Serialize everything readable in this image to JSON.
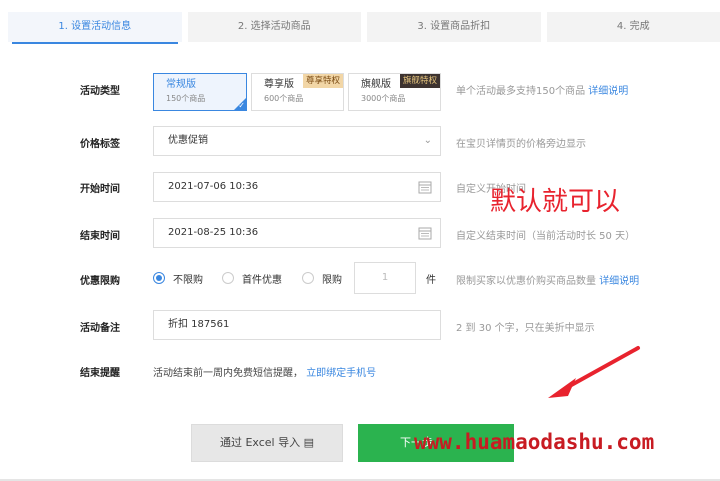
{
  "steps": [
    "1. 设置活动信息",
    "2. 选择活动商品",
    "3. 设置商品折扣",
    "4. 完成"
  ],
  "activity_type": {
    "label": "活动类型",
    "cards": [
      {
        "title": "常规版",
        "sub": "150个商品",
        "tag": ""
      },
      {
        "title": "尊享版",
        "sub": "600个商品",
        "tag": "尊享特权"
      },
      {
        "title": "旗舰版",
        "sub": "3000个商品",
        "tag": "旗舰特权"
      }
    ],
    "hint": "单个活动最多支持150个商品",
    "hint_link": "详细说明"
  },
  "price_tag": {
    "label": "价格标签",
    "value": "优惠促销",
    "hint": "在宝贝详情页的价格旁边显示"
  },
  "start_time": {
    "label": "开始时间",
    "value": "2021-07-06 10:36",
    "hint": "自定义开始时间"
  },
  "end_time": {
    "label": "结束时间",
    "value": "2021-08-25 10:36",
    "hint": "自定义结束时间（当前活动时长 50 天）"
  },
  "limit": {
    "label": "优惠限购",
    "options": [
      "不限购",
      "首件优惠",
      "限购"
    ],
    "qty": "1",
    "unit": "件",
    "hint": "限制买家以优惠价购买商品数量",
    "hint_link": "详细说明"
  },
  "remark": {
    "label": "活动备注",
    "value": "折扣 187561",
    "hint": "2 到 30 个字，只在美折中显示"
  },
  "remind": {
    "label": "结束提醒",
    "text": "活动结束前一周内免费短信提醒，",
    "link": "立即绑定手机号"
  },
  "buttons": {
    "excel": "通过 Excel 导入",
    "next": "下一步"
  },
  "overlay": {
    "note": "默认就可以",
    "watermark": "www.huamaodashu.com"
  },
  "colors": {
    "accent": "#3a87e0",
    "green": "#2bb34f",
    "red": "#e8232e"
  }
}
